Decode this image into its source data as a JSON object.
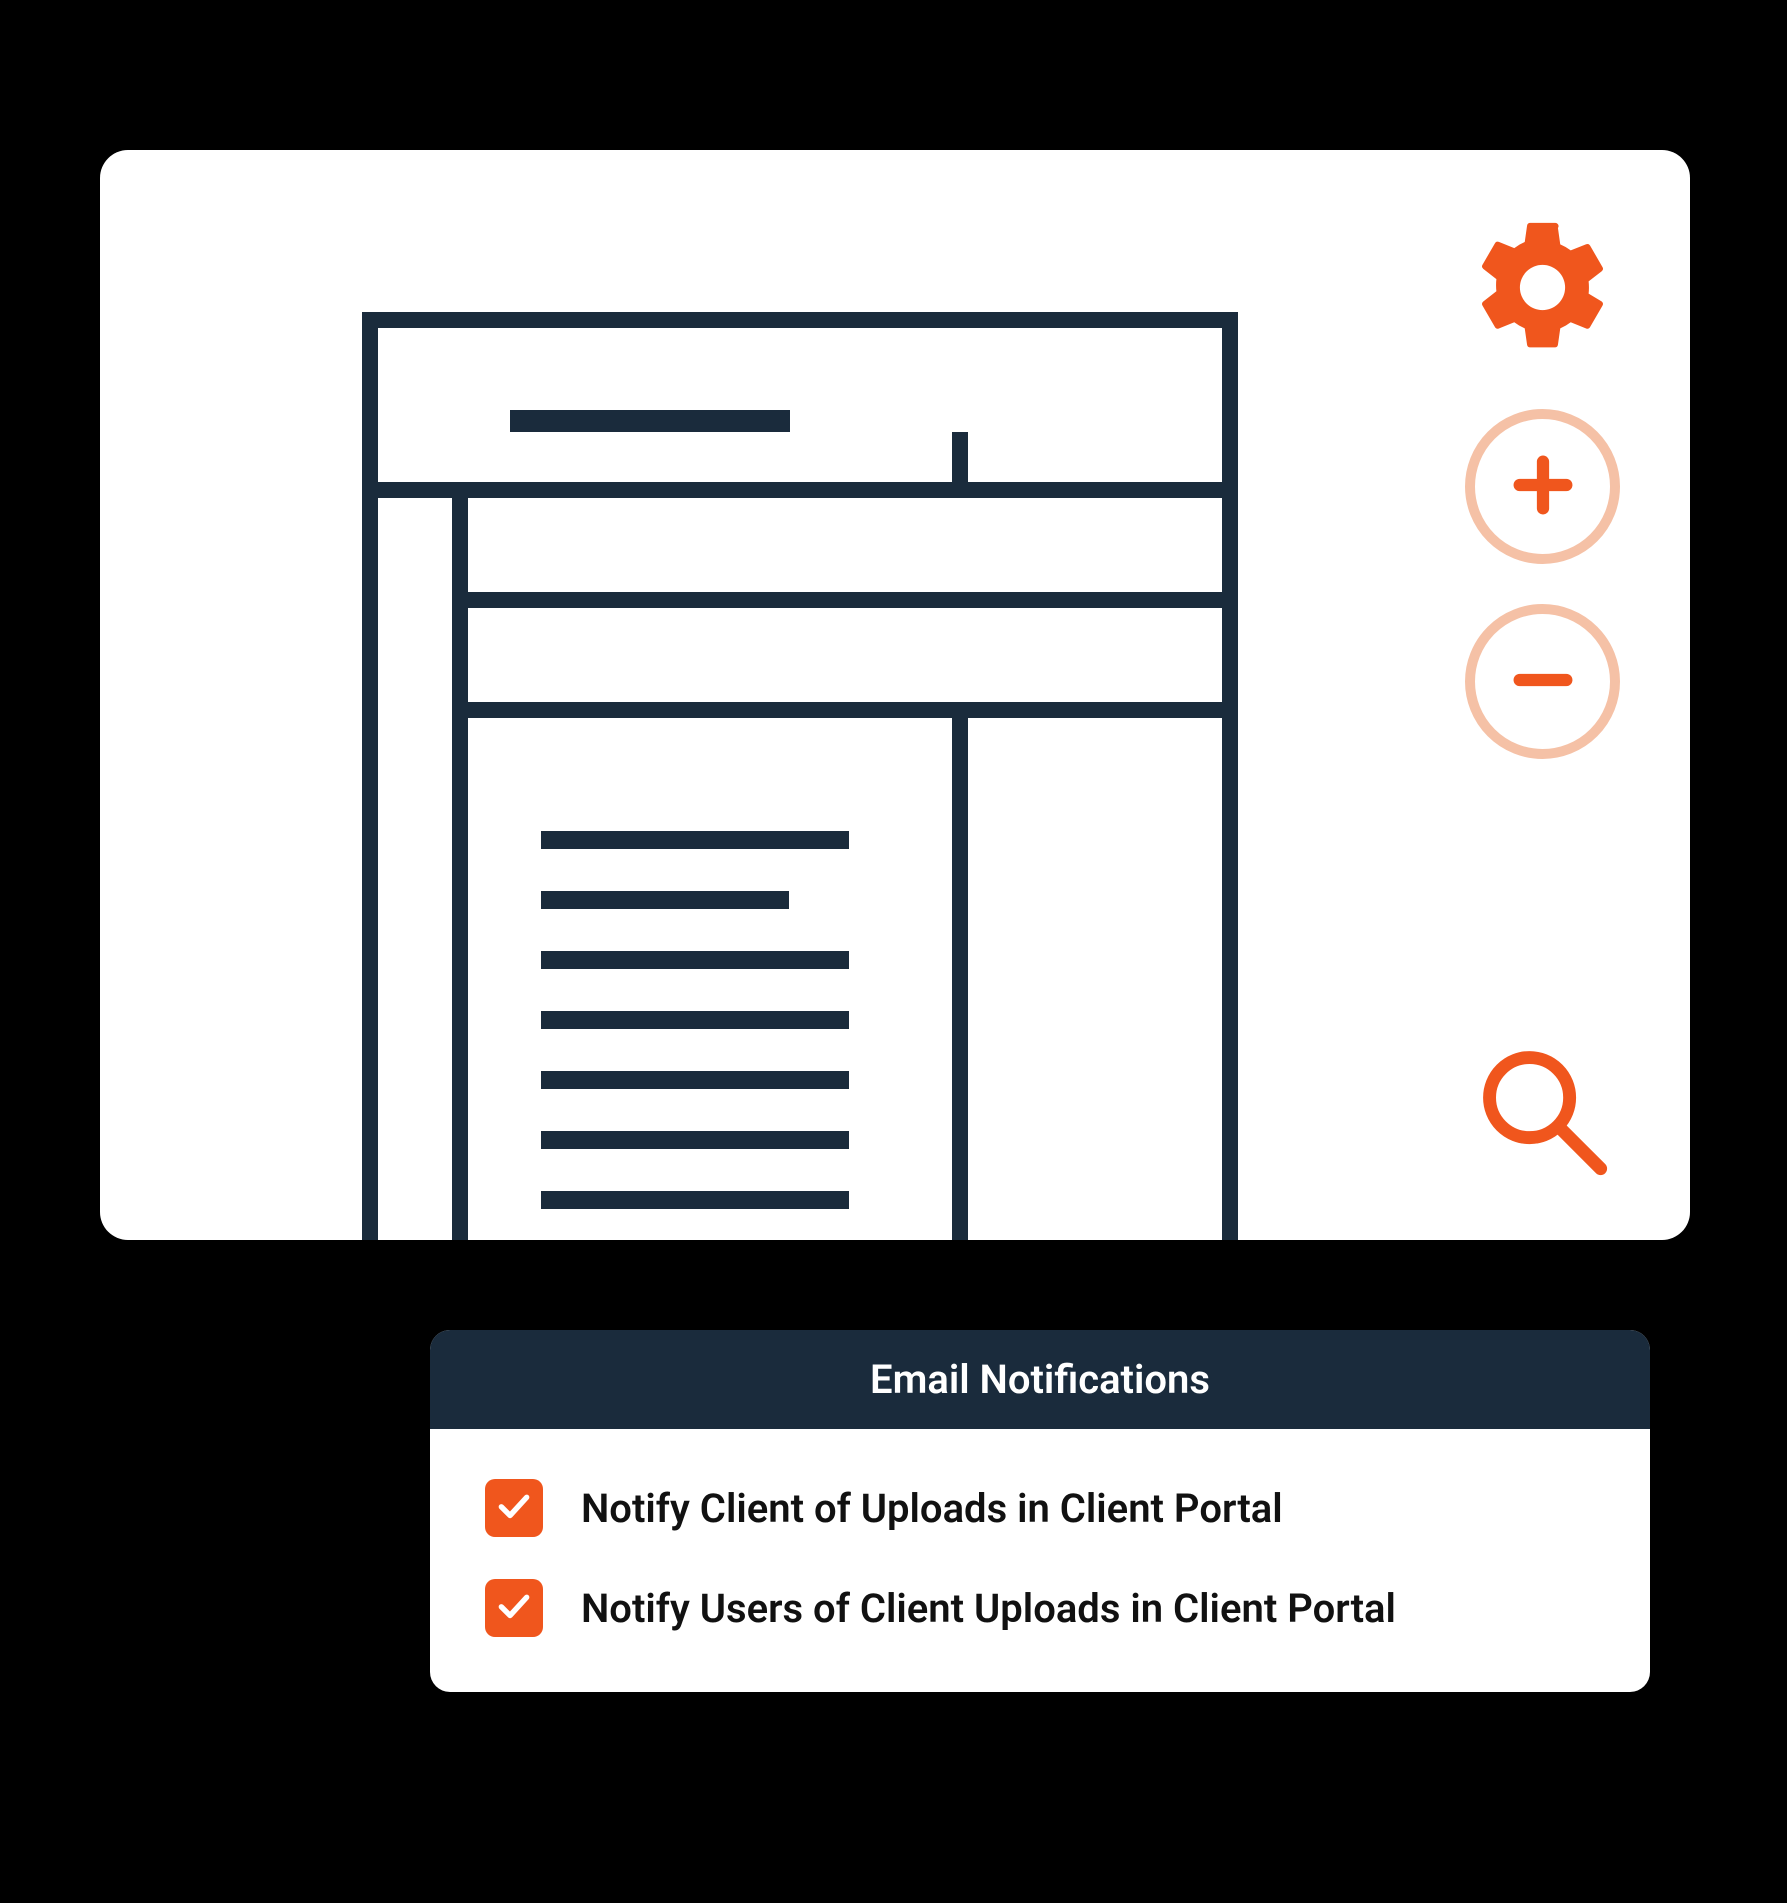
{
  "colors": {
    "accent": "#f0561d",
    "accent_light": "#f5c1a6",
    "dark": "#1a2b3c"
  },
  "toolbar": {
    "gear": "gear-icon",
    "zoom_in": "plus-icon",
    "zoom_out": "minus-icon",
    "search": "search-icon"
  },
  "panel": {
    "title": "Email Notifications",
    "options": [
      {
        "label": "Notify Client of Uploads in Client Portal",
        "checked": true
      },
      {
        "label": "Notify Users of Client Uploads in Client Portal",
        "checked": true
      }
    ]
  }
}
